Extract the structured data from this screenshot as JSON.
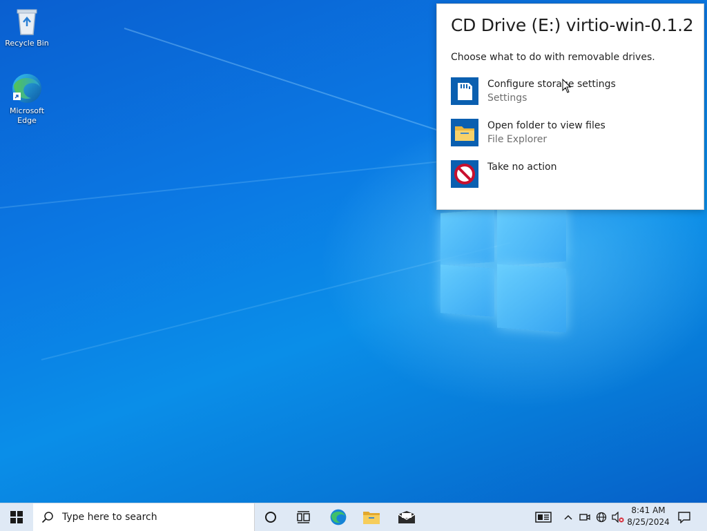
{
  "desktop": {
    "icons": [
      {
        "label": "Recycle Bin",
        "icon": "recycle-bin-icon"
      },
      {
        "label": "Microsoft Edge",
        "icon": "edge-icon"
      }
    ]
  },
  "autoplay": {
    "title": "CD Drive (E:) virtio-win-0.1.2...",
    "prompt": "Choose what to do with removable drives.",
    "options": [
      {
        "label": "Configure storage settings",
        "sublabel": "Settings",
        "icon": "sd-card-icon"
      },
      {
        "label": "Open folder to view files",
        "sublabel": "File Explorer",
        "icon": "folder-icon"
      },
      {
        "label": "Take no action",
        "sublabel": "",
        "icon": "no-action-icon"
      }
    ]
  },
  "taskbar": {
    "search_placeholder": "Type here to search",
    "pinned": [
      "cortana-icon",
      "task-view-icon",
      "edge-icon",
      "file-explorer-icon",
      "mail-icon"
    ],
    "tray": [
      "news-icon",
      "chevron-up-icon",
      "meet-now-icon",
      "network-icon",
      "volume-muted-icon"
    ],
    "time": "8:41 AM",
    "date": "8/25/2024"
  },
  "colors": {
    "taskbar_bg": "#dfe9f5",
    "desktop_blue": "#0a78e3",
    "option_icon_bg": "#0a5fb0",
    "muted_text": "#6e6e6e"
  }
}
